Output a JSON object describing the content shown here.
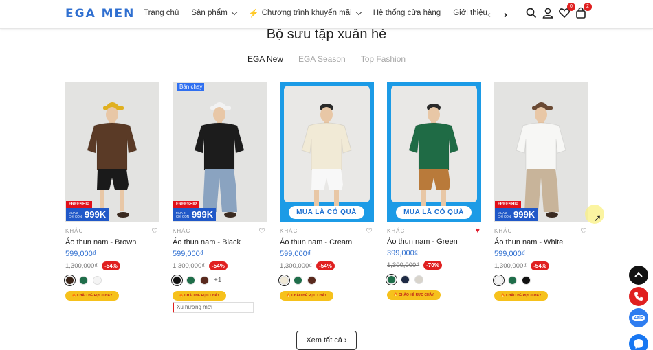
{
  "header": {
    "logo": "EGA MEN",
    "nav": [
      {
        "label": "Trang chủ",
        "has_dropdown": false
      },
      {
        "label": "Sản phẩm",
        "has_dropdown": true
      },
      {
        "label": "Chương trình khuyến mãi",
        "has_dropdown": true,
        "icon": "bolt-icon"
      },
      {
        "label": "Hệ thống cửa hàng",
        "has_dropdown": false
      },
      {
        "label": "Giới thiệu",
        "has_dropdown": false
      }
    ],
    "wishlist_count": "0",
    "cart_count": "2"
  },
  "section": {
    "title": "Bộ sưu tập xuân hè",
    "tabs": [
      {
        "label": "EGA New",
        "active": true
      },
      {
        "label": "EGA Season",
        "active": false
      },
      {
        "label": "Top Fashion",
        "active": false
      }
    ],
    "see_all": "Xem tất cả"
  },
  "products": [
    {
      "category": "KHÁC",
      "name": "Áo thun nam - Brown",
      "price": "599,000₫",
      "old_price": "1,300,000₫",
      "discount": "-54%",
      "image_style": "grey",
      "shirt_color": "#5a3a26",
      "pants_color": "#1a1a1a",
      "hat_color": "#e0b020",
      "freeship": "FREESHIP",
      "badge_small": "MUA 2 CHỈ CÒN",
      "badge_big": "999K",
      "bestseller": "",
      "promo": "",
      "swatches": [
        "#3a2418",
        "#1f6e4a",
        "#f4f4f4"
      ],
      "selected": 0,
      "more": "",
      "liked": false,
      "sale_tag": "CHÀO HÈ RỰC CHÁY",
      "trend": ""
    },
    {
      "category": "KHÁC",
      "name": "Áo thun nam - Black",
      "price": "599,000₫",
      "old_price": "1,300,000₫",
      "discount": "-54%",
      "image_style": "grey",
      "shirt_color": "#1c1c1c",
      "pants_color": "#8aa3c0",
      "hat_color": "#f2f2f2",
      "freeship": "FREESHIP",
      "badge_small": "MUA 2 CHỈ CÒN",
      "badge_big": "999K",
      "bestseller": "Bán chạy",
      "promo": "",
      "swatches": [
        "#111111",
        "#1f6e4a",
        "#5a2a1e"
      ],
      "selected": 0,
      "more": "+1",
      "liked": false,
      "sale_tag": "CHÀO HÈ RỰC CHÁY",
      "trend": "Xu hướng mới"
    },
    {
      "category": "KHÁC",
      "name": "Áo thun nam - Cream",
      "price": "599,000₫",
      "old_price": "1,300,000₫",
      "discount": "-54%",
      "image_style": "blue",
      "shirt_color": "#f1ead6",
      "pants_color": "#f8f8f8",
      "hat_color": "",
      "freeship": "",
      "badge_small": "",
      "badge_big": "",
      "bestseller": "",
      "promo": "MUA LÀ CÓ QUÀ",
      "swatches": [
        "#efe8d6",
        "#1f6e4a",
        "#5a2a1e"
      ],
      "selected": 0,
      "more": "",
      "liked": false,
      "sale_tag": "CHÀO HÈ RỰC CHÁY",
      "trend": ""
    },
    {
      "category": "KHÁC",
      "name": "Áo thun nam - Green",
      "price": "399,000₫",
      "old_price": "1,300,000₫",
      "discount": "-70%",
      "image_style": "blue",
      "shirt_color": "#1f6b45",
      "pants_color": "#b97a3a",
      "hat_color": "",
      "freeship": "",
      "badge_small": "",
      "badge_big": "",
      "bestseller": "",
      "promo": "MUA LÀ CÓ QUÀ",
      "swatches": [
        "#1f6e4a",
        "#1e2a44",
        "#d8d4cc"
      ],
      "selected": 0,
      "more": "",
      "liked": true,
      "sale_tag": "CHÀO HÈ RỰC CHÁY",
      "trend": ""
    },
    {
      "category": "KHÁC",
      "name": "Áo thun nam - White",
      "price": "599,000₫",
      "old_price": "1,300,000₫",
      "discount": "-54%",
      "image_style": "grey",
      "shirt_color": "#f7f7f5",
      "pants_color": "#c8b49a",
      "hat_color": "#6a4a34",
      "freeship": "FREESHIP",
      "badge_small": "MUA 2 CHỈ CÒN",
      "badge_big": "999K",
      "bestseller": "",
      "promo": "",
      "swatches": [
        "#f4f4f4",
        "#1f6e4a",
        "#111111"
      ],
      "selected": 0,
      "more": "",
      "liked": false,
      "sale_tag": "CHÀO HÈ RỰC CHÁY",
      "trend": ""
    }
  ],
  "floating": [
    {
      "name": "back-to-top-button",
      "color": "#111111",
      "icon": "chevron-up-icon"
    },
    {
      "name": "phone-button",
      "color": "#e02020",
      "icon": "phone-icon"
    },
    {
      "name": "zalo-button",
      "color": "#2f7df0",
      "icon": "zalo-icon",
      "label": "Zalo"
    },
    {
      "name": "messenger-button",
      "color": "#1877f2",
      "icon": "messenger-icon"
    }
  ],
  "colors": {
    "accent": "#2f6fd0",
    "sale": "#e02020"
  }
}
